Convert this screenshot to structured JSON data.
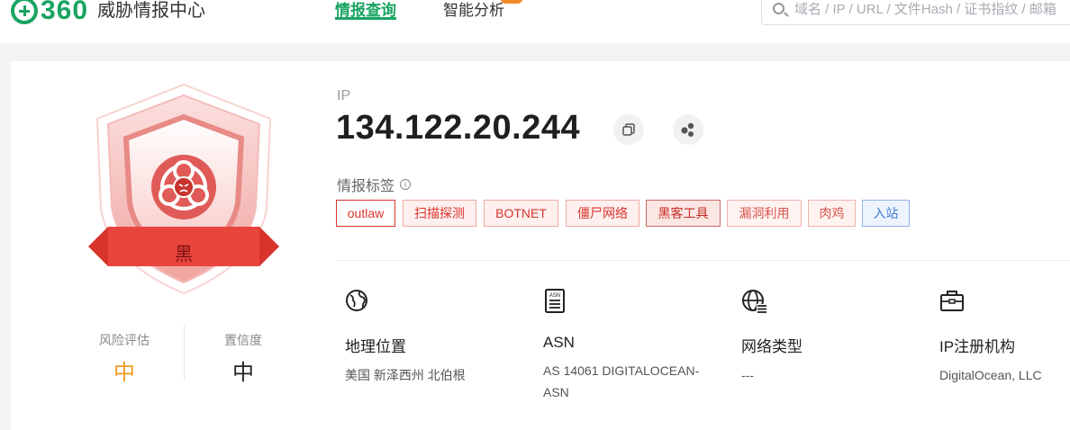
{
  "brand": {
    "logo_number": "360",
    "site_name": "威胁情报中心",
    "color": "#1aa463"
  },
  "nav": {
    "active_tab": "情报查询",
    "other_tab": "智能分析"
  },
  "search": {
    "placeholder": "域名 / IP / URL / 文件Hash / 证书指纹 / 邮箱"
  },
  "verdict": {
    "level": "黑",
    "color": "#d9342b"
  },
  "metrics": {
    "risk_label": "风险评估",
    "risk_value": "中",
    "confidence_label": "置信度",
    "confidence_value": "中"
  },
  "target": {
    "type": "IP",
    "value": "134.122.20.244"
  },
  "tags_title": "情报标签",
  "tags": [
    "outlaw",
    "扫描探测",
    "BOTNET",
    "僵尸网络",
    "黑客工具",
    "漏洞利用",
    "肉鸡",
    "入站"
  ],
  "info": {
    "geo": {
      "title": "地理位置",
      "value": "美国 新泽西州 北伯根",
      "icon": "globe-icon"
    },
    "asn": {
      "title": "ASN",
      "value": "AS 14061 DIGITALOCEAN-ASN",
      "icon": "document-icon"
    },
    "network": {
      "title": "网络类型",
      "value": "---",
      "icon": "network-globe-icon"
    },
    "registrar": {
      "title": "IP注册机构",
      "value": "DigitalOcean, LLC",
      "icon": "briefcase-icon"
    }
  }
}
